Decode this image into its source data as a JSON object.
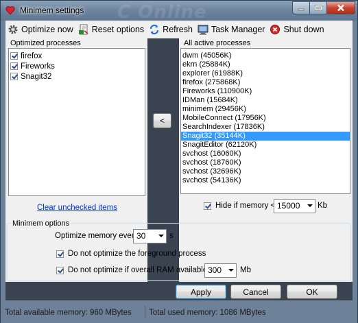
{
  "window": {
    "title": "Minimem settings",
    "watermark": "C Online"
  },
  "toolbar": {
    "optimize_now": "Optimize now",
    "reset_options": "Reset options",
    "refresh": "Refresh",
    "task_manager": "Task Manager",
    "shut_down": "Shut down"
  },
  "optimized": {
    "label": "Optimized processes",
    "items": [
      "firefox",
      "Fireworks",
      "Snagit32"
    ],
    "clear_link": "Clear unchecked items"
  },
  "move_button": "<",
  "active": {
    "label": "All active processes",
    "items": [
      "dwm (45056K)",
      "ekrn (25884K)",
      "explorer (61988K)",
      "firefox (275868K)",
      "Fireworks (110900K)",
      "IDMan (15684K)",
      "minimem (29456K)",
      "MobileConnect (17956K)",
      "SearchIndexer (17836K)",
      "Snagit32 (35144K)",
      "SnagitEditor (62120K)",
      "svchost (16060K)",
      "svchost (18760K)",
      "svchost (32696K)",
      "svchost (54136K)"
    ],
    "selected_index": 9,
    "hide_label": "Hide if memory <",
    "hide_value": "15000",
    "hide_unit": "Kb"
  },
  "options": {
    "label": "Minimem options",
    "every_label": "Optimize memory every",
    "every_value": "30",
    "every_unit": "s",
    "foreground_label": "Do not optimize the foreground process",
    "ram_label": "Do not optimize if overall RAM available >",
    "ram_value": "300",
    "ram_unit": "Mb"
  },
  "buttons": {
    "apply": "Apply",
    "cancel": "Cancel",
    "ok": "OK"
  },
  "status": {
    "total_available": "Total available memory: 960 MBytes",
    "total_used": "Total used memory: 1086 MBytes"
  },
  "colors": {
    "selection": "#3399ff",
    "frame": "#6d8299",
    "close": "#c8432f",
    "link": "#0033cc"
  }
}
